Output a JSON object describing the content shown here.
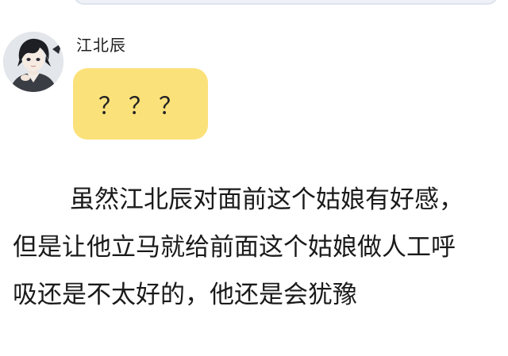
{
  "chat": {
    "message": {
      "username": "江北辰",
      "bubble_text": "？？？",
      "avatar_icon": "anime-boy-avatar-icon"
    }
  },
  "narration": {
    "lines": [
      "虽然江北辰对面前这个姑娘有好感，",
      "但是让他立马就给前面这个姑娘做人工呼",
      "吸还是不太好的，他还是会犹豫"
    ]
  },
  "colors": {
    "bubble": "#fbe17a",
    "top_bubble": "#eef1f7",
    "text": "#1a1a1a"
  }
}
